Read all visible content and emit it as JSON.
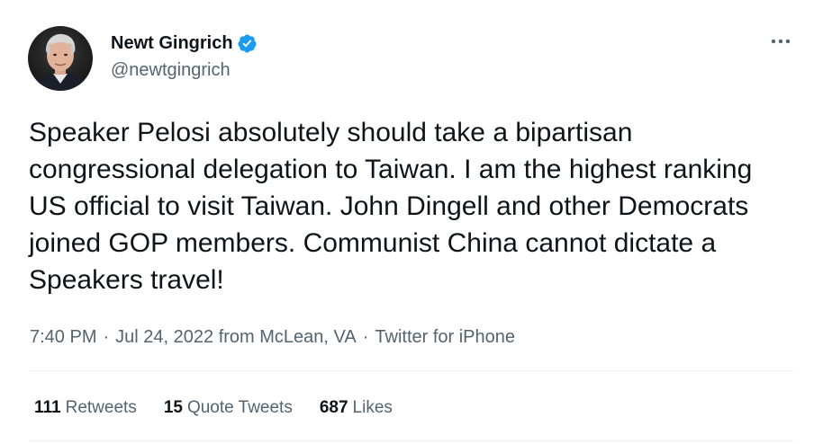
{
  "author": {
    "name": "Newt Gingrich",
    "handle": "@newtgingrich",
    "verified": true,
    "verified_color": "#1d9bf0"
  },
  "more_icon": "more-horizontal-icon",
  "tweet": {
    "text": "Speaker Pelosi absolutely should take a bipartisan congressional delegation to Taiwan. I am the highest ranking US official to visit Taiwan. John Dingell and other Democrats joined GOP members. Communist China cannot dictate a Speakers travel!"
  },
  "meta": {
    "time": "7:40 PM",
    "separator": "·",
    "date_location": "Jul 24, 2022 from McLean, VA",
    "source": "Twitter for iPhone"
  },
  "stats": {
    "retweets_count": "111",
    "retweets_label": "Retweets",
    "quotes_count": "15",
    "quotes_label": "Quote Tweets",
    "likes_count": "687",
    "likes_label": "Likes"
  },
  "colors": {
    "text_primary": "#0f1419",
    "text_secondary": "#536471",
    "divider": "#eff3f4"
  }
}
